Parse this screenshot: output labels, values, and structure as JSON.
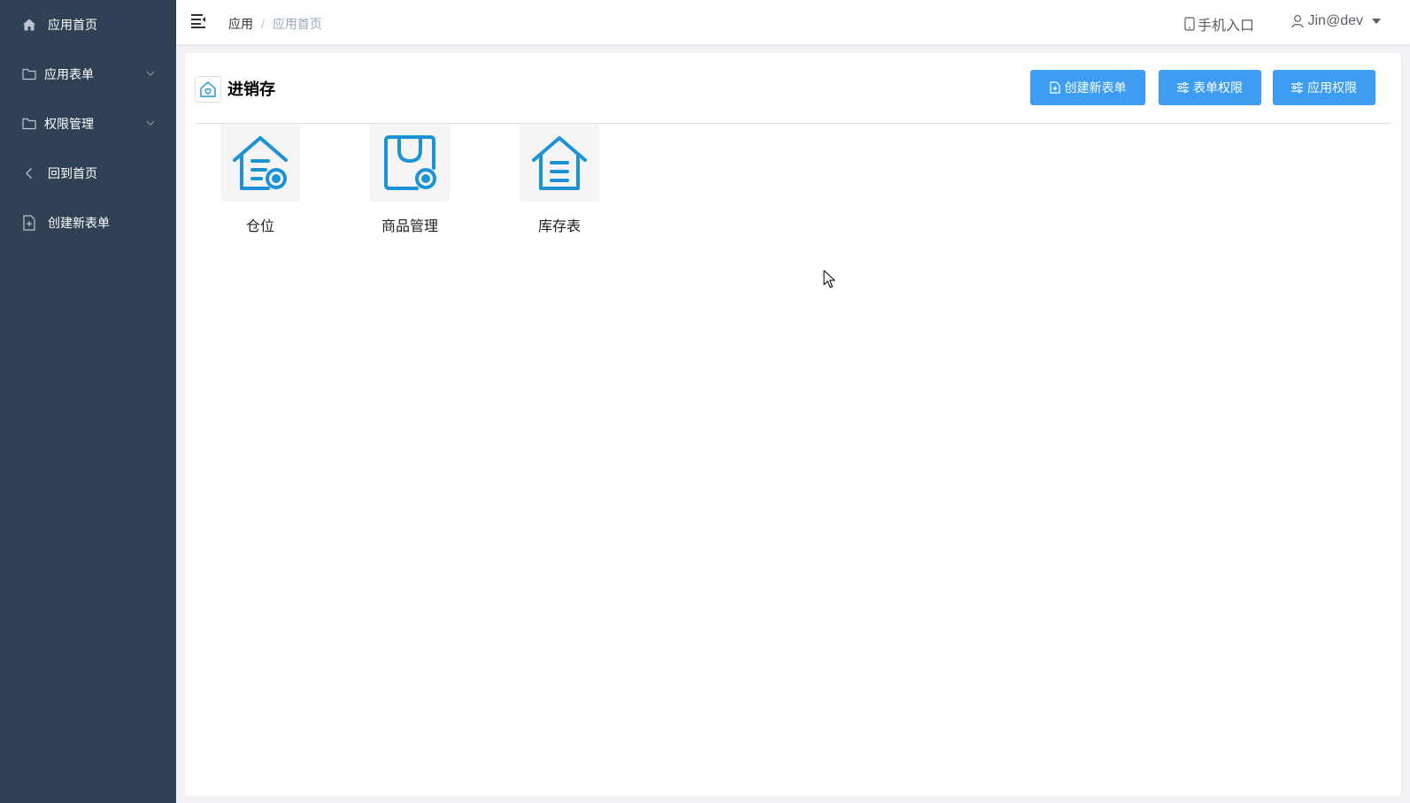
{
  "sidebar": {
    "items": [
      {
        "label": "应用首页",
        "icon": "home-icon"
      },
      {
        "label": "应用表单",
        "icon": "folder-icon",
        "expandable": true
      },
      {
        "label": "权限管理",
        "icon": "folder-icon",
        "expandable": true
      },
      {
        "label": "回到首页",
        "icon": "chevron-left-icon"
      },
      {
        "label": "创建新表单",
        "icon": "file-add-icon"
      }
    ]
  },
  "navbar": {
    "breadcrumb": [
      "应用",
      "应用首页"
    ],
    "breadcrumb_separator": "/",
    "mobile_entry": "手机入口",
    "user": "Jin@dev"
  },
  "app": {
    "title": "进销存",
    "buttons": {
      "create_form": "创建新表单",
      "form_permission": "表单权限",
      "app_permission": "应用权限"
    },
    "forms": [
      {
        "label": "仓位",
        "icon": "house-doc-record-icon"
      },
      {
        "label": "商品管理",
        "icon": "bag-record-icon"
      },
      {
        "label": "库存表",
        "icon": "house-doc-icon"
      }
    ]
  },
  "colors": {
    "sidebar_bg": "#304156",
    "primary": "#3d9df3",
    "icon_blue": "#1b93d6"
  }
}
